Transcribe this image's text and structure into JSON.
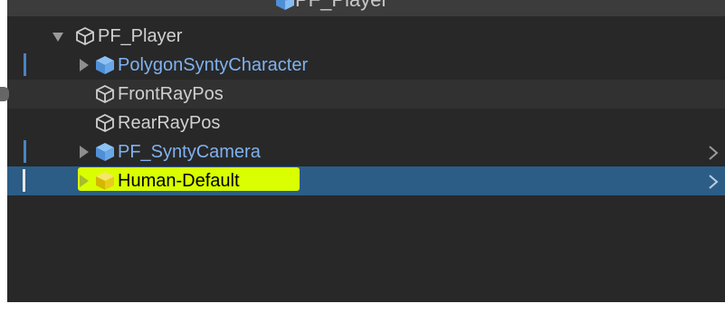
{
  "header": {
    "title": "PF_Player",
    "icon": "prefab-cube-icon"
  },
  "hierarchy": {
    "items": [
      {
        "label": "PF_Player",
        "kind": "gameobject",
        "expanded": true,
        "icon": "cube-outline-icon"
      },
      {
        "label": "PolygonSyntyCharacter",
        "kind": "prefab",
        "expanded": false,
        "icon": "prefab-cube-icon"
      },
      {
        "label": "FrontRayPos",
        "kind": "gameobject",
        "icon": "cube-outline-icon"
      },
      {
        "label": "RearRayPos",
        "kind": "gameobject",
        "icon": "cube-outline-icon"
      },
      {
        "label": "PF_SyntyCamera",
        "kind": "prefab",
        "expanded": false,
        "icon": "prefab-cube-icon"
      },
      {
        "label": "Human-Default",
        "kind": "prefab",
        "expanded": false,
        "selected": true,
        "highlighted": true,
        "icon": "prefab-cube-yellow-icon"
      }
    ]
  },
  "colors": {
    "panel_bg": "#282828",
    "selected_bg": "#2c5d87",
    "prefab_text": "#7fb2f0",
    "highlight": "#d9ff00"
  }
}
